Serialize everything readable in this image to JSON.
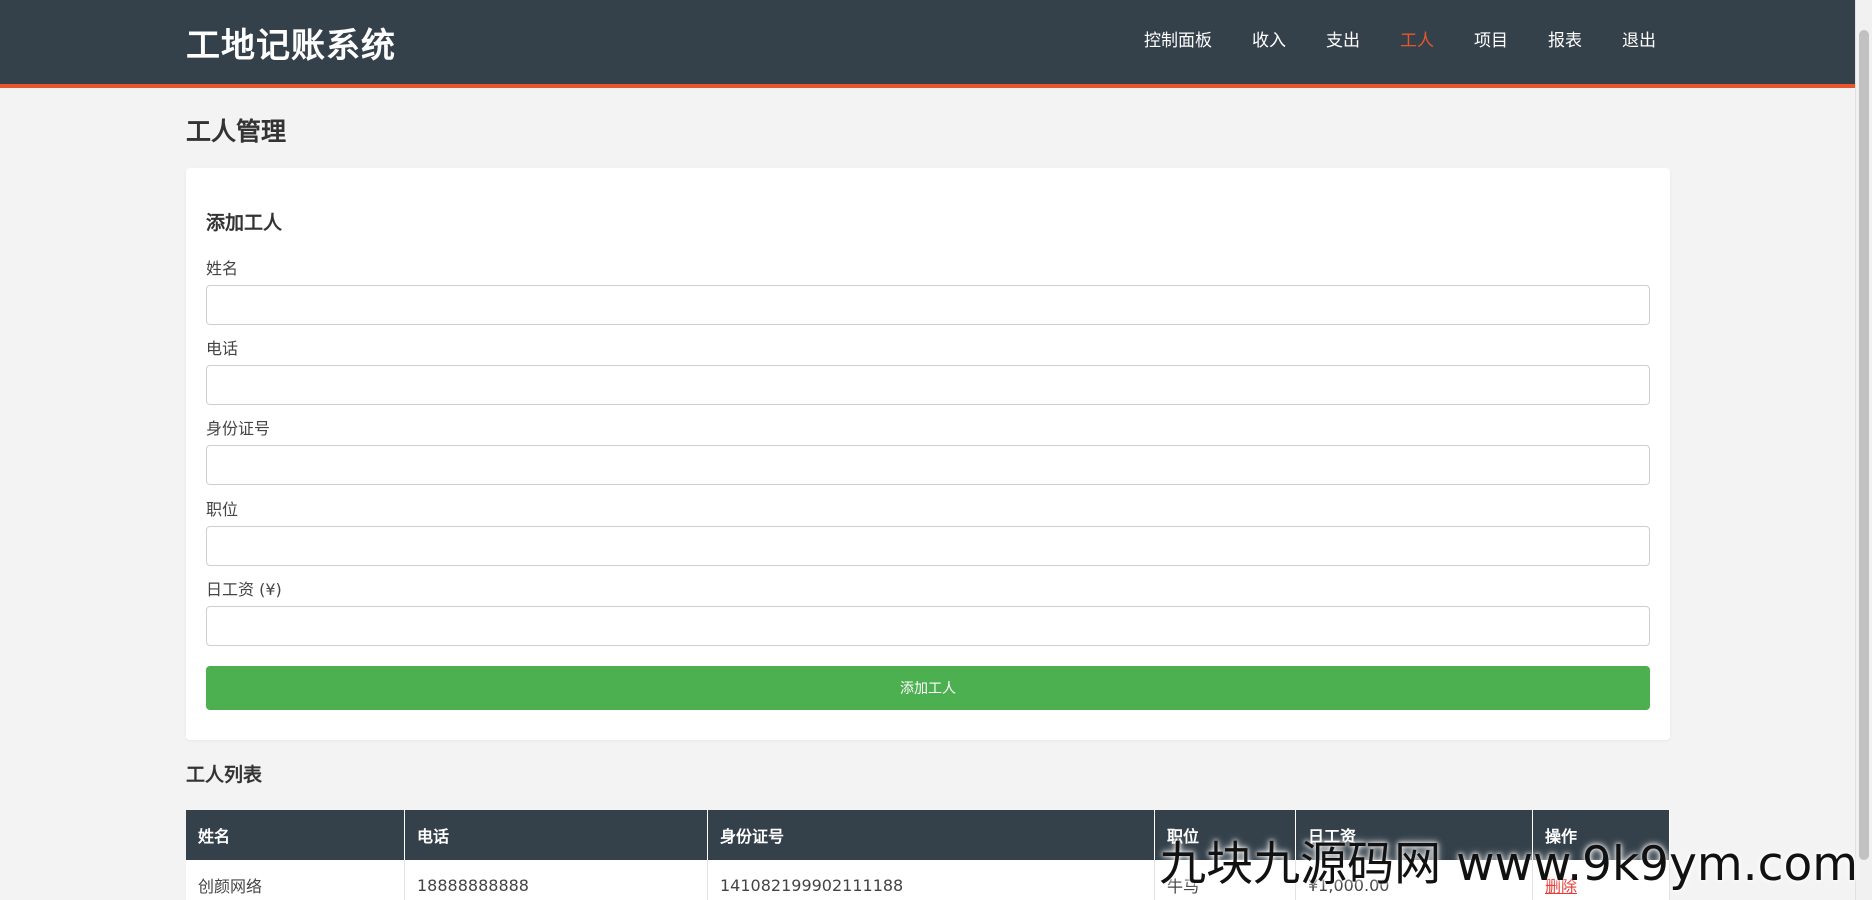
{
  "header": {
    "brand": "工地记账系统",
    "nav": [
      {
        "label": "控制面板"
      },
      {
        "label": "收入"
      },
      {
        "label": "支出"
      },
      {
        "label": "工人",
        "active": true
      },
      {
        "label": "项目"
      },
      {
        "label": "报表"
      },
      {
        "label": "退出"
      }
    ],
    "accent_color": "#e8562a",
    "bg_color": "#34404a"
  },
  "page": {
    "title": "工人管理"
  },
  "form": {
    "title": "添加工人",
    "fields": {
      "name": {
        "label": "姓名",
        "value": ""
      },
      "phone": {
        "label": "电话",
        "value": ""
      },
      "id_number": {
        "label": "身份证号",
        "value": ""
      },
      "position": {
        "label": "职位",
        "value": ""
      },
      "daily_wage": {
        "label": "日工资 (¥)",
        "value": ""
      }
    },
    "submit_label": "添加工人",
    "submit_color": "#4caf50"
  },
  "list": {
    "title": "工人列表",
    "columns": [
      "姓名",
      "电话",
      "身份证号",
      "职位",
      "日工资",
      "操作"
    ],
    "rows": [
      {
        "name": "创颜网络",
        "phone": "18888888888",
        "id_number": "141082199902111188",
        "position": "牛马",
        "wage": "¥1,000.00",
        "action": "删除"
      }
    ]
  },
  "watermark": "九块九源码网 www.9k9ym.com"
}
